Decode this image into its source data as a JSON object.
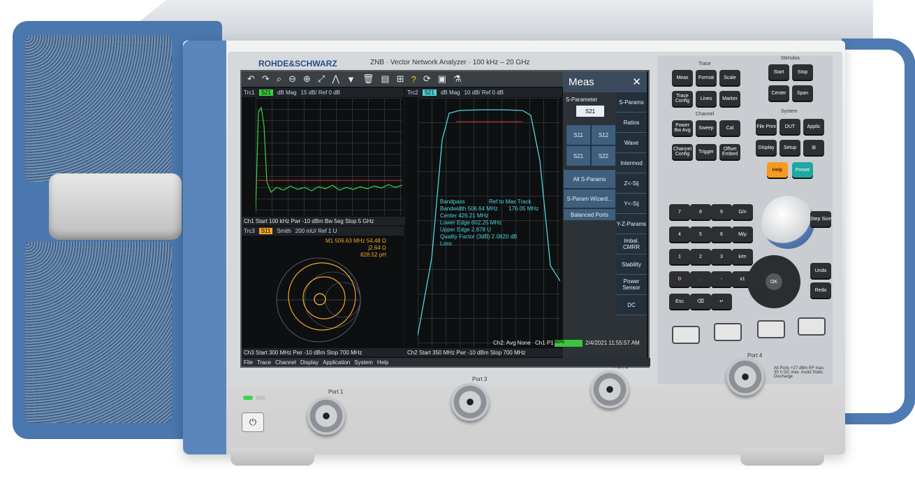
{
  "device": {
    "brand": "ROHDE&SCHWARZ",
    "model": "ZNB",
    "title": "Vector Network Analyzer",
    "range": "100 kHz – 20 GHz"
  },
  "trace1": {
    "label": "Trc1",
    "param": "S21",
    "format": "dB Mag",
    "scale": "15 dB/ Ref 0 dB",
    "footer": "Ch1  Start  100 kHz  Pwr  -10 dBm  Bw  5eg    Stop  5 GHz"
  },
  "trace2": {
    "label": "Trc2",
    "param": "S21",
    "format": "dB Mag",
    "scale": "10 dB/ Ref 0 dB",
    "footer": "Ch2  Start  350 MHz     Pwr  -10 dBm     Stop  700 MHz"
  },
  "trace3": {
    "label": "Trc3",
    "param": "S11",
    "format": "Smith",
    "scale": "200 mU/ Ref 1 U",
    "marker": "M1  506.63  MHz   54.48  Ω",
    "marker2": "j2.64  Ω",
    "marker3": "828.52  pH",
    "footer": "Ch3  Start  300 MHz     Pwr  -10 dBm     Stop  700 MHz"
  },
  "bandpass": {
    "title": "Bandpass",
    "ref": "Ref to Max  Track",
    "rows": [
      "Bandwidth   506.64 MHz",
      "Center   426.21 MHz",
      "Lower Edge   602.25 MHz",
      "Upper Edge   2.878 U",
      "Quality Factor (3dB)   2.0820 dB",
      "Loss"
    ],
    "bw": "176.05 MHz"
  },
  "status": {
    "avg": "Ch2: Avg None",
    "port": "Ch1 P1",
    "progress": "80%",
    "datetime": "2/4/2021 11:55:57 AM"
  },
  "meas": {
    "title": "Meas",
    "close": "✕",
    "section": "S-Parameter",
    "selector": "S21",
    "buttons": [
      "S11",
      "S12",
      "S21",
      "S22"
    ],
    "all": "All S-Params",
    "wizard": "S-Param Wizard...",
    "balanced": "Balanced Ports",
    "tabs": [
      "S-Params",
      "Ratios",
      "Wave",
      "Intermod",
      "Z<-Sij",
      "Y<-Sij",
      "Y-Z-Params",
      "Imbal. CMRR",
      "Stability",
      "Power Sensor",
      "DC"
    ]
  },
  "menu": [
    "File",
    "Trace",
    "Channel",
    "Display",
    "Application",
    "System",
    "Help"
  ],
  "keys": {
    "trace_group": "Trace",
    "trace": [
      "Meas",
      "Format",
      "Scale",
      "Trace Config",
      "Lines",
      "Marker"
    ],
    "channel_group": "Channel",
    "channel": [
      "Power Bw Avg",
      "Sweep",
      "Cal",
      "Channel Config",
      "Trigger",
      "Offset Embed"
    ],
    "stimulus_group": "Stimulus",
    "stimulus": [
      "Start",
      "Stop",
      "Center",
      "Span"
    ],
    "system_group": "System",
    "system": [
      "File Print",
      "DUT",
      "Applic",
      "Display",
      "Setup",
      "⊞",
      "Help",
      "Preset"
    ],
    "num": [
      "7",
      "8",
      "9",
      "G/n",
      "4",
      "5",
      "6",
      "M/μ",
      "1",
      "2",
      "3",
      "k/m",
      "0",
      ".",
      "-",
      "x1",
      "Esc",
      "⌫",
      "↵"
    ],
    "step": "Step Size",
    "undo": "Undo",
    "redo": "Redo",
    "ok": "OK"
  },
  "ports": [
    "Port 1",
    "Port 3",
    "Port 2",
    "Port 4"
  ],
  "warning": "All Ports +27 dBm RF max. 30 V DC max. Avoid Static Discharge",
  "colors": {
    "trace_green": "#39d43a",
    "trace_cyan": "#4fd6d8",
    "trace_orange": "#f5a623",
    "accent_blue": "#4a77ad"
  }
}
